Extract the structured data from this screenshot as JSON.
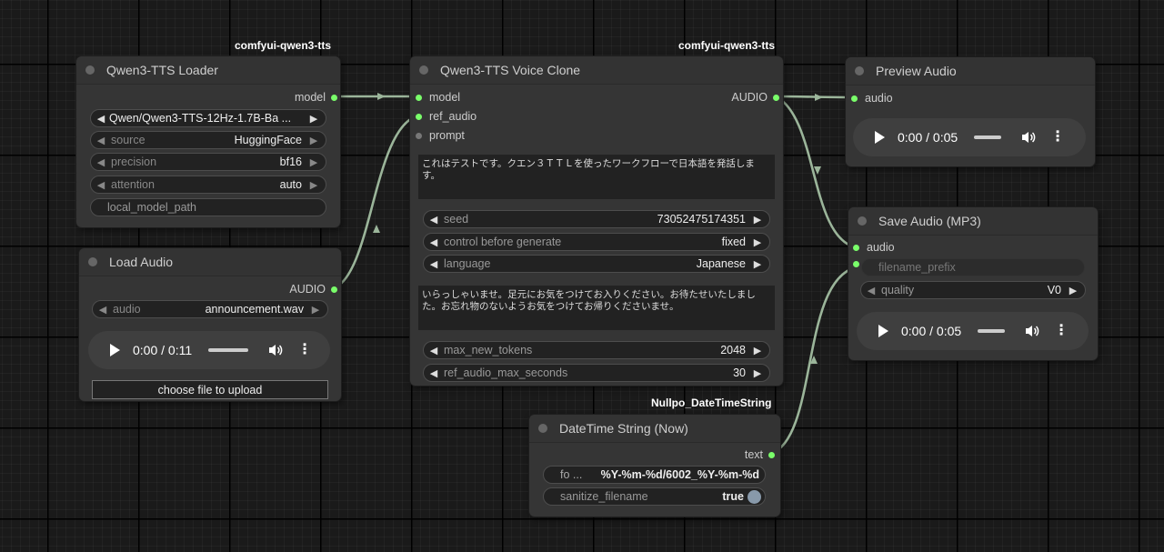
{
  "colors": {
    "canvas": "#1a1a1a",
    "node_bg": "#353535",
    "link": "#9bb59a",
    "slot_connected": "#7aff6a",
    "slot_empty": "#777777"
  },
  "badges": {
    "loader": "comfyui-qwen3-tts",
    "clone": "comfyui-qwen3-tts",
    "datetime": "Nullpo_DateTimeString"
  },
  "loader": {
    "title": "Qwen3-TTS Loader",
    "output_model": "model",
    "model_value": "Qwen/Qwen3-TTS-12Hz-1.7B-Ba ...",
    "source_label": "source",
    "source_value": "HuggingFace",
    "precision_label": "precision",
    "precision_value": "bf16",
    "attention_label": "attention",
    "attention_value": "auto",
    "local_model_path": "local_model_path"
  },
  "load_audio": {
    "title": "Load Audio",
    "output_audio": "AUDIO",
    "audio_label": "audio",
    "audio_value": "announcement.wav",
    "player_time": "0:00 / 0:11",
    "upload_label": "choose file to upload"
  },
  "voice_clone": {
    "title": "Qwen3-TTS Voice Clone",
    "input_model": "model",
    "input_ref_audio": "ref_audio",
    "input_prompt": "prompt",
    "output_audio": "AUDIO",
    "text": "これはテストです。クエン３ＴＴＬを使ったワークフローで日本語を発話します。",
    "seed_label": "seed",
    "seed_value": "73052475174351",
    "control_label": "control before generate",
    "control_value": "fixed",
    "language_label": "language",
    "language_value": "Japanese",
    "ref_text": "いらっしゃいませ。足元にお気をつけてお入りください。お待たせいたしました。お忘れ物のないようお気をつけてお帰りくださいませ。",
    "max_tokens_label": "max_new_tokens",
    "max_tokens_value": "2048",
    "ref_max_label": "ref_audio_max_seconds",
    "ref_max_value": "30"
  },
  "preview": {
    "title": "Preview Audio",
    "input_audio": "audio",
    "player_time": "0:00 / 0:05"
  },
  "save": {
    "title": "Save Audio (MP3)",
    "input_audio": "audio",
    "filename_prefix": "filename_prefix",
    "quality_label": "quality",
    "quality_value": "V0",
    "player_time": "0:00 / 0:05"
  },
  "datetime": {
    "title": "DateTime String (Now)",
    "output_text": "text",
    "format_label": "fo ...",
    "format_value": "%Y-%m-%d/6002_%Y-%m-%d",
    "sanitize_label": "sanitize_filename",
    "sanitize_value": "true"
  }
}
